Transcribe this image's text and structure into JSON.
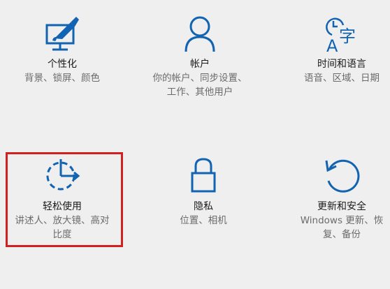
{
  "tiles": {
    "personalization": {
      "icon": "personalization-icon",
      "title": "个性化",
      "desc_lines": [
        "背景、锁屏、颜色"
      ]
    },
    "accounts": {
      "icon": "person-icon",
      "title": "帐户",
      "desc_lines": [
        "你的帐户、同步设置、",
        "工作、其他用户"
      ]
    },
    "time_language": {
      "icon": "time-language-icon",
      "title": "时间和语言",
      "desc_lines": [
        "语音、区域、日期"
      ]
    },
    "ease_of_access": {
      "icon": "ease-of-access-icon",
      "title": "轻松使用",
      "desc_lines": [
        "讲述人、放大镜、高对",
        "比度"
      ]
    },
    "privacy": {
      "icon": "lock-icon",
      "title": "隐私",
      "desc_lines": [
        "位置、相机"
      ]
    },
    "update_security": {
      "icon": "refresh-icon",
      "title": "更新和安全",
      "desc_lines": [
        "Windows 更新、恢",
        "复、备份"
      ]
    }
  },
  "colors": {
    "accent": "#1263b2",
    "highlight": "#d21f1f",
    "background": "#efefef",
    "title": "#1a1a1a",
    "desc": "#6b6b6b"
  }
}
